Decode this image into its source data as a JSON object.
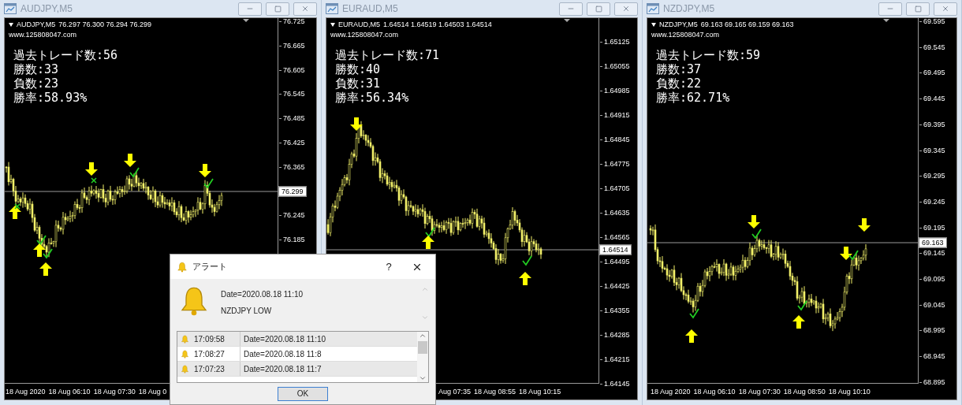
{
  "windows": [
    {
      "title": "AUDJPY,M5",
      "symbol": "AUDJPY,M5",
      "quote": "76.297 76.300 76.294 76.299",
      "url": "www.125808047.com",
      "stats": [
        "過去トレード数:56",
        "勝数:33",
        "負数:23",
        "勝率:58.93%"
      ],
      "price_ticks": [
        "76.725",
        "76.665",
        "76.605",
        "76.545",
        "76.485",
        "76.425",
        "76.365",
        "76.245",
        "76.185"
      ],
      "current_price": "76.299",
      "time_labels": [
        "18 Aug 2020",
        "18 Aug 06:10",
        "18 Aug 07:30",
        "18 Aug 0"
      ]
    },
    {
      "title": "EURAUD,M5",
      "symbol": "EURAUD,M5",
      "quote": "1.64514 1.64519 1.64503 1.64514",
      "url": "www.125808047.com",
      "stats": [
        "過去トレード数:71",
        "勝数:40",
        "負数:31",
        "勝率:56.34%"
      ],
      "price_ticks": [
        "1.65125",
        "1.65055",
        "1.64985",
        "1.64915",
        "1.64845",
        "1.64775",
        "1.64705",
        "1.64635",
        "1.64565",
        "1.64495",
        "1.64425",
        "1.64355",
        "1.64285",
        "1.64215",
        "1.64145"
      ],
      "current_price": "1.64514",
      "time_labels": [
        "Aug 07:35",
        "18 Aug 08:55",
        "18 Aug 10:15"
      ]
    },
    {
      "title": "NZDJPY,M5",
      "symbol": "NZDJPY,M5",
      "quote": "69.163 69.165 69.159 69.163",
      "url": "www.125808047.com",
      "stats": [
        "過去トレード数:59",
        "勝数:37",
        "負数:22",
        "勝率:62.71%"
      ],
      "price_ticks": [
        "69.595",
        "69.545",
        "69.495",
        "69.445",
        "69.395",
        "69.345",
        "69.295",
        "69.245",
        "69.195",
        "69.145",
        "69.095",
        "69.045",
        "68.995",
        "68.945",
        "68.895"
      ],
      "current_price": "69.163",
      "time_labels": [
        "18 Aug 2020",
        "18 Aug 06:10",
        "18 Aug 07:30",
        "18 Aug 08:50",
        "18 Aug 10:10"
      ]
    }
  ],
  "alert_dialog": {
    "title": "アラート",
    "help": "?",
    "message": "Date=2020.08.18 11:10",
    "symbol_line": "NZDJPY LOW",
    "rows": [
      {
        "time": "17:09:58",
        "text": "Date=2020.08.18 11:10"
      },
      {
        "time": "17:08:27",
        "text": "Date=2020.08.18 11:8"
      },
      {
        "time": "17:07:23",
        "text": "Date=2020.08.18 11:7"
      }
    ],
    "ok": "OK"
  }
}
